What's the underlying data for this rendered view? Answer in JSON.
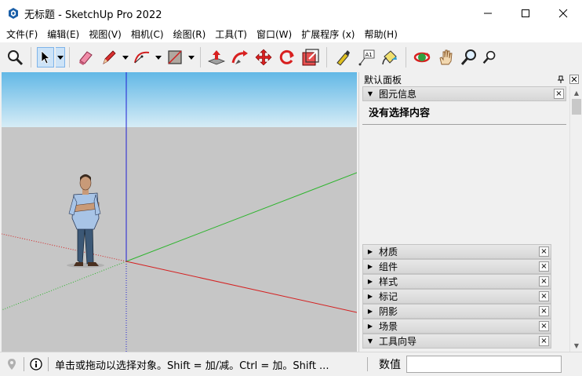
{
  "window": {
    "title": "无标题 - SketchUp Pro 2022"
  },
  "menu": {
    "items": [
      {
        "label": "文件(F)"
      },
      {
        "label": "编辑(E)"
      },
      {
        "label": "视图(V)"
      },
      {
        "label": "相机(C)"
      },
      {
        "label": "绘图(R)"
      },
      {
        "label": "工具(T)"
      },
      {
        "label": "窗口(W)"
      },
      {
        "label": "扩展程序 (x)"
      },
      {
        "label": "帮助(H)"
      }
    ]
  },
  "toolbar": {
    "tools": [
      "zoom-search-icon",
      "select-arrow-icon",
      "eraser-icon",
      "pencil-icon",
      "arc-icon",
      "rectangle-icon",
      "push-pull-icon",
      "follow-me-icon",
      "move-icon",
      "rotate-icon",
      "scale-icon",
      "tape-measure-icon",
      "text-label-icon",
      "paint-bucket-icon",
      "orbit-icon",
      "pan-hand-icon",
      "zoom-icon",
      "zoom-extents-icon"
    ]
  },
  "tray": {
    "title": "默认面板",
    "entity_info": {
      "label": "图元信息",
      "content": "没有选择内容"
    },
    "panels": [
      {
        "label": "材质",
        "expanded": false
      },
      {
        "label": "组件",
        "expanded": false
      },
      {
        "label": "样式",
        "expanded": false
      },
      {
        "label": "标记",
        "expanded": false
      },
      {
        "label": "阴影",
        "expanded": false
      },
      {
        "label": "场景",
        "expanded": false
      },
      {
        "label": "工具向导",
        "expanded": true
      }
    ]
  },
  "status": {
    "message": "单击或拖动以选择对象。Shift = 加/减。Ctrl = 加。Shift ...",
    "measurement_label": "数值",
    "measurement_value": ""
  },
  "colors": {
    "sky_top": "#62b8e6",
    "sky_bottom": "#d6ecf6",
    "ground": "#c6c6c6",
    "axis_red": "#d42020",
    "axis_green": "#2cb42c",
    "axis_blue": "#2020d4"
  }
}
